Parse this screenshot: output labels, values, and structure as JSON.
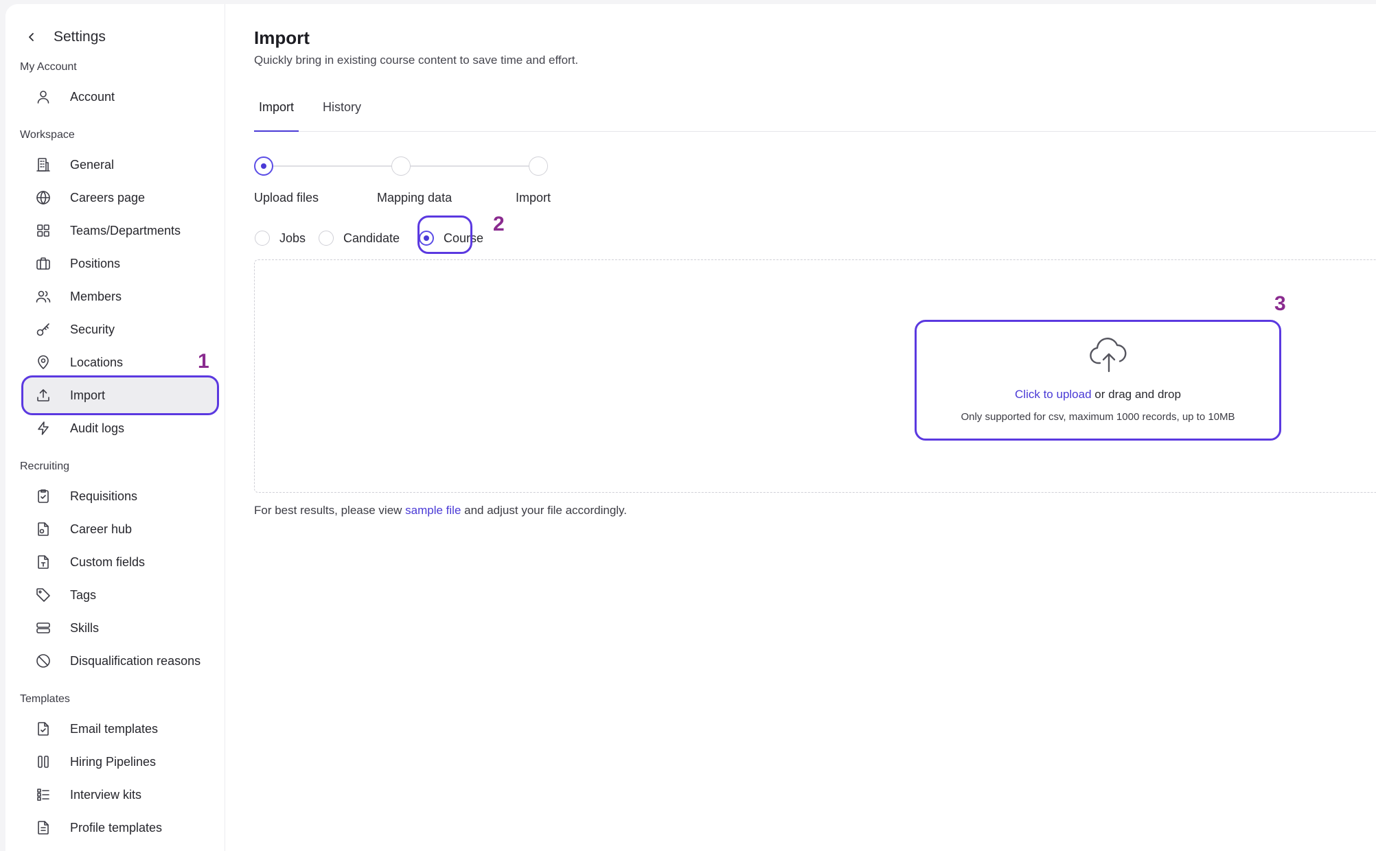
{
  "sidebar": {
    "title": "Settings",
    "sections": {
      "my_account": "My Account",
      "workspace": "Workspace",
      "recruiting": "Recruiting",
      "templates": "Templates"
    },
    "items": {
      "account": "Account",
      "general": "General",
      "careers_page": "Careers page",
      "teams": "Teams/Departments",
      "positions": "Positions",
      "members": "Members",
      "security": "Security",
      "locations": "Locations",
      "import": "Import",
      "audit_logs": "Audit logs",
      "requisitions": "Requisitions",
      "career_hub": "Career hub",
      "custom_fields": "Custom fields",
      "tags": "Tags",
      "skills": "Skills",
      "disqualification": "Disqualification reasons",
      "email_templates": "Email templates",
      "hiring_pipelines": "Hiring Pipelines",
      "interview_kits": "Interview kits",
      "profile_templates": "Profile templates"
    },
    "active_item": "import"
  },
  "main": {
    "title": "Import",
    "subtitle": "Quickly bring in existing course content to save time and effort.",
    "tabs": {
      "import": "Import",
      "history": "History"
    },
    "active_tab": "import",
    "steps": [
      "Upload files",
      "Mapping data",
      "Import"
    ],
    "active_step": 0,
    "import_types": {
      "jobs": "Jobs",
      "candidate": "Candidate",
      "course": "Course"
    },
    "selected_type": "course",
    "upload": {
      "link_text": "Click to upload",
      "rest_text": " or drag and drop",
      "note": "Only supported for csv, maximum 1000 records, up to 10MB"
    },
    "hint": {
      "before": "For best results, please view ",
      "link": "sample file",
      "after": " and adjust your file accordingly."
    }
  },
  "annotations": {
    "one": "1",
    "two": "2",
    "three": "3"
  },
  "colors": {
    "accent": "#4a3ad6",
    "annotation_ring": "#5b39e0",
    "annotation_number": "#8a2b8f"
  }
}
